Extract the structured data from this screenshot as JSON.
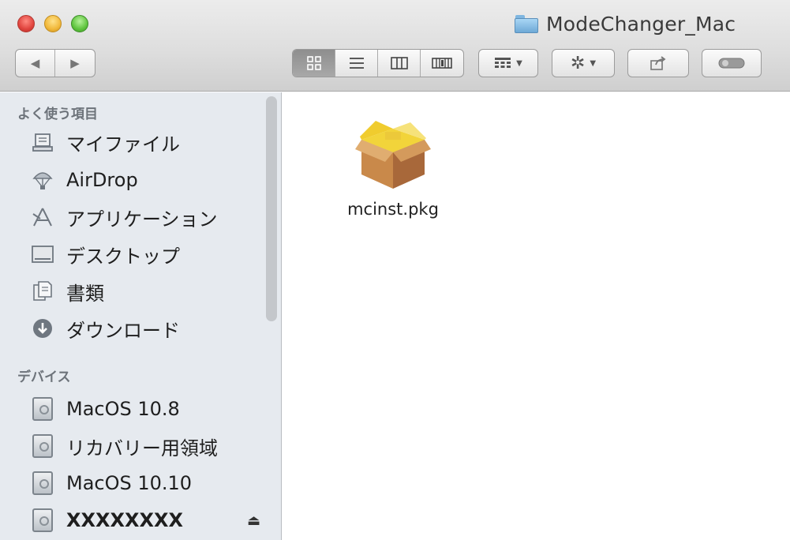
{
  "window": {
    "title": "ModeChanger_Mac"
  },
  "toolbar": {
    "back_label": "◀",
    "forward_label": "▶",
    "view_icon": "icon-view-icon",
    "view_list": "list-view-icon",
    "view_column": "column-view-icon",
    "view_coverflow": "coverflow-view-icon",
    "arrange_icon": "arrange-icon",
    "action_icon": "gear-icon",
    "share_icon": "share-icon",
    "tag_icon": "toggle-tag-icon"
  },
  "sidebar": {
    "favorites_heading": "よく使う項目",
    "favorites": [
      {
        "label": "マイファイル",
        "icon": "all-files-icon"
      },
      {
        "label": "AirDrop",
        "icon": "airdrop-icon"
      },
      {
        "label": "アプリケーション",
        "icon": "applications-icon"
      },
      {
        "label": "デスクトップ",
        "icon": "desktop-icon"
      },
      {
        "label": "書類",
        "icon": "documents-icon"
      },
      {
        "label": "ダウンロード",
        "icon": "downloads-icon"
      }
    ],
    "devices_heading": "デバイス",
    "devices": [
      {
        "label": "MacOS 10.8",
        "icon": "disk-icon"
      },
      {
        "label": "リカバリー用領域",
        "icon": "disk-icon"
      },
      {
        "label": "MacOS 10.10",
        "icon": "disk-icon"
      },
      {
        "label": "XXXXXXXX",
        "icon": "disk-icon",
        "eject": "⏏"
      }
    ]
  },
  "content": {
    "files": [
      {
        "name": "mcinst.pkg",
        "icon": "package-icon"
      }
    ]
  },
  "colors": {
    "sidebar_bg": "#e6eaef",
    "package_tan": "#d8a464",
    "package_yellow": "#f2d43a"
  }
}
